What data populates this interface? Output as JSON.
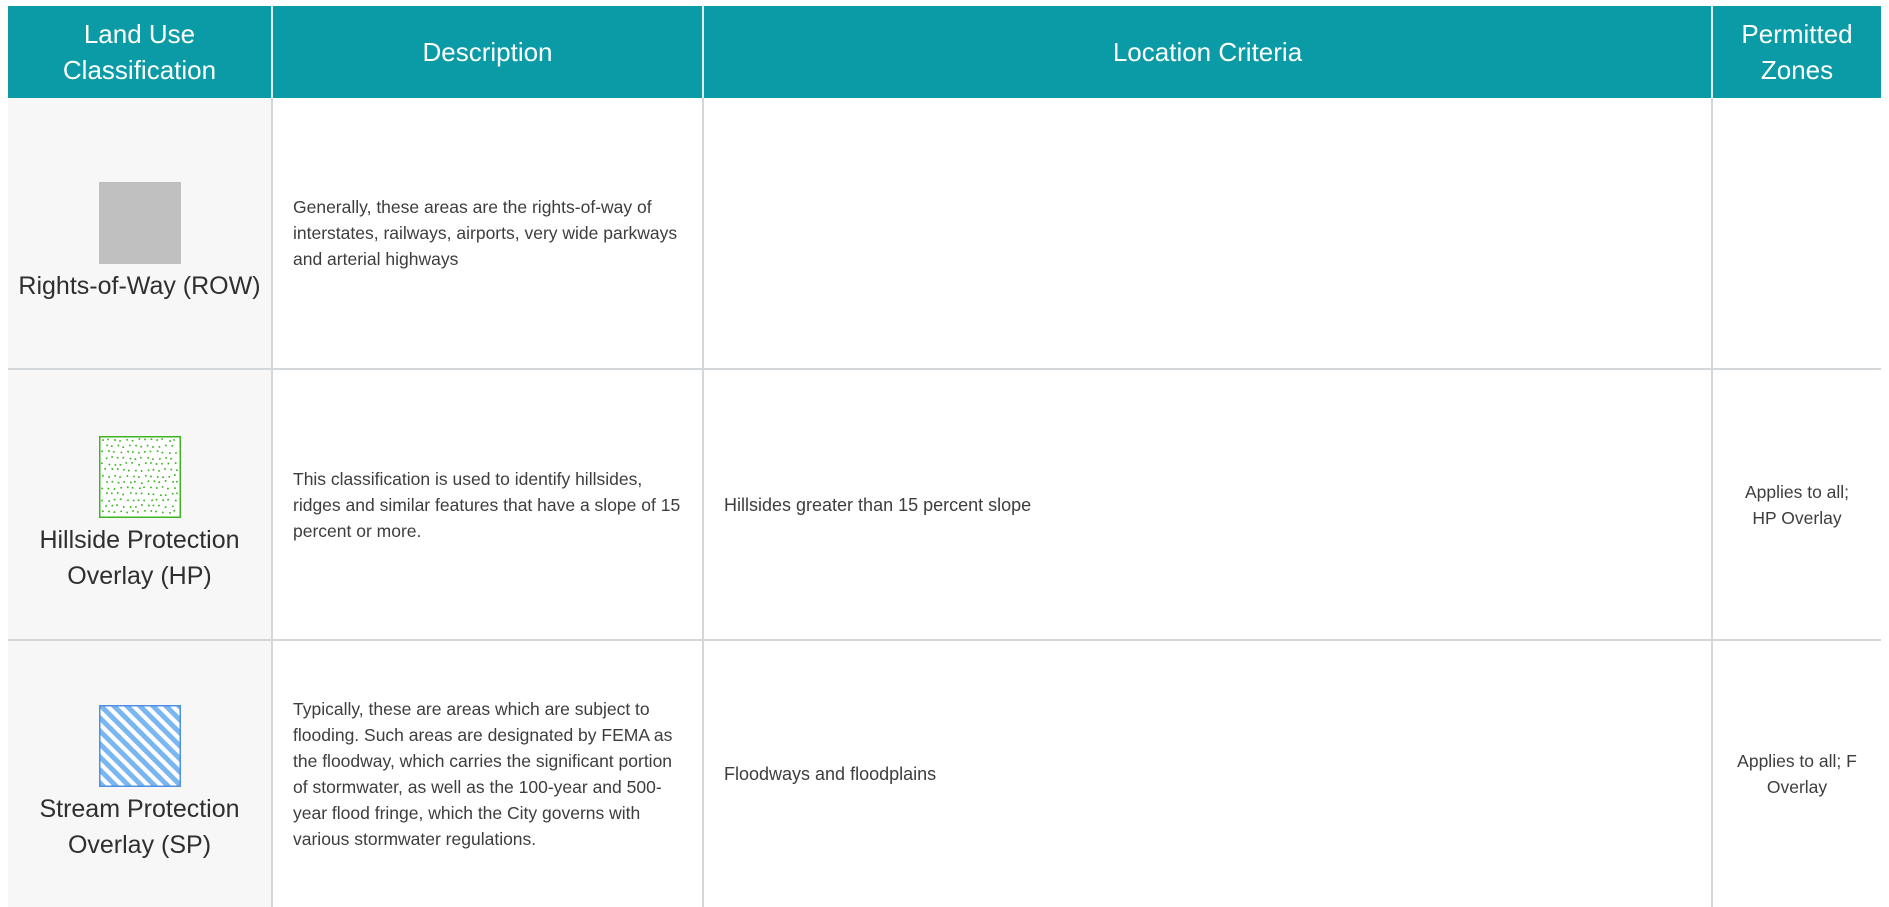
{
  "header": {
    "classification": "Land Use Classification",
    "description": "Description",
    "location": "Location Criteria",
    "zones": "Permitted Zones"
  },
  "rows": [
    {
      "classification": "Rights-of-Way (ROW)",
      "swatch_icon": "gray-fill-swatch-icon",
      "swatch_color": "#c0c0c0",
      "description": "Generally, these areas are the rights-of-way of interstates, railways, airports, very wide parkways and arterial highways",
      "location": "",
      "zones": ""
    },
    {
      "classification": "Hillside Protection Overlay (HP)",
      "swatch_icon": "green-dot-pattern-swatch-icon",
      "swatch_color": "#3cb521",
      "description": "This classification is used to identify hillsides, ridges and similar features that have a slope of 15 percent or more.",
      "location": "Hillsides greater than 15 percent slope",
      "zones": "Applies to all; HP Overlay"
    },
    {
      "classification": "Stream Protection Overlay (SP)",
      "swatch_icon": "blue-diagonal-hatch-swatch-icon",
      "swatch_color": "#4f8fe6",
      "description": "Typically, these are areas which are subject to flooding. Such areas are designated by FEMA as the floodway, which carries the significant portion of stormwater, as well as the 100-year and 500-year flood fringe, which the City governs with various stormwater regulations.",
      "location": "Floodways and floodplains",
      "zones": "Applies to all; F Overlay"
    }
  ],
  "colors": {
    "header_bg": "#0a9ba6",
    "header_text": "#ffffff",
    "grid_line": "#d3d7d9",
    "classification_bg": "#f7f7f7"
  }
}
